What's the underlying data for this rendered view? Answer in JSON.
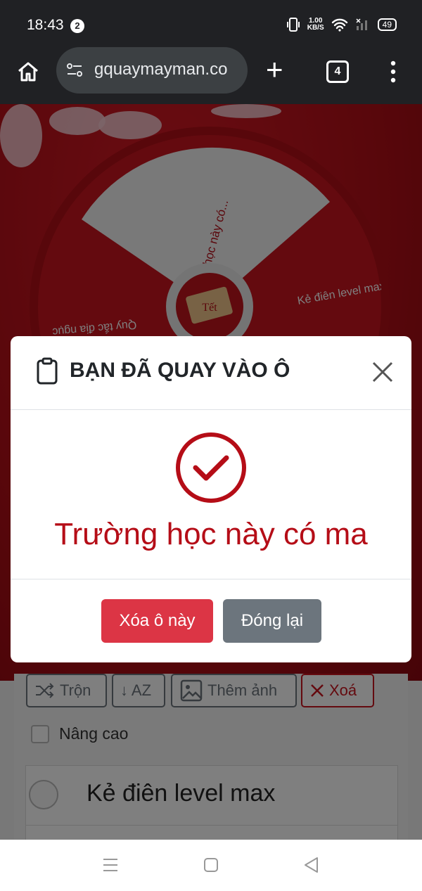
{
  "status_bar": {
    "time": "18:43",
    "notification_count": "2",
    "net_speed_value": "1.00",
    "net_speed_unit": "KB/S",
    "battery": "49"
  },
  "browser": {
    "url": "gquaymayman.co",
    "tab_count": "4"
  },
  "wheel": {
    "segments": [
      "Trường học này có...",
      "Kẻ điên level max",
      "Quy tắc địa ngục"
    ],
    "center_logo_text": "Tết"
  },
  "toolbar": {
    "shuffle_label": "Trộn",
    "sort_label": "↓ AZ",
    "add_image_label": "Thêm ảnh",
    "delete_label": "Xoá",
    "advanced_label": "Nâng cao"
  },
  "list": {
    "items": [
      {
        "label": "Kẻ điên level max"
      }
    ]
  },
  "modal": {
    "title": "BẠN ĐÃ QUAY VÀO Ô",
    "result": "Trường học này có ma",
    "delete_button": "Xóa ô này",
    "close_button": "Đóng lại"
  },
  "colors": {
    "accent_red": "#b50d17",
    "danger_button": "#dc3545",
    "secondary_button": "#6c757d"
  }
}
